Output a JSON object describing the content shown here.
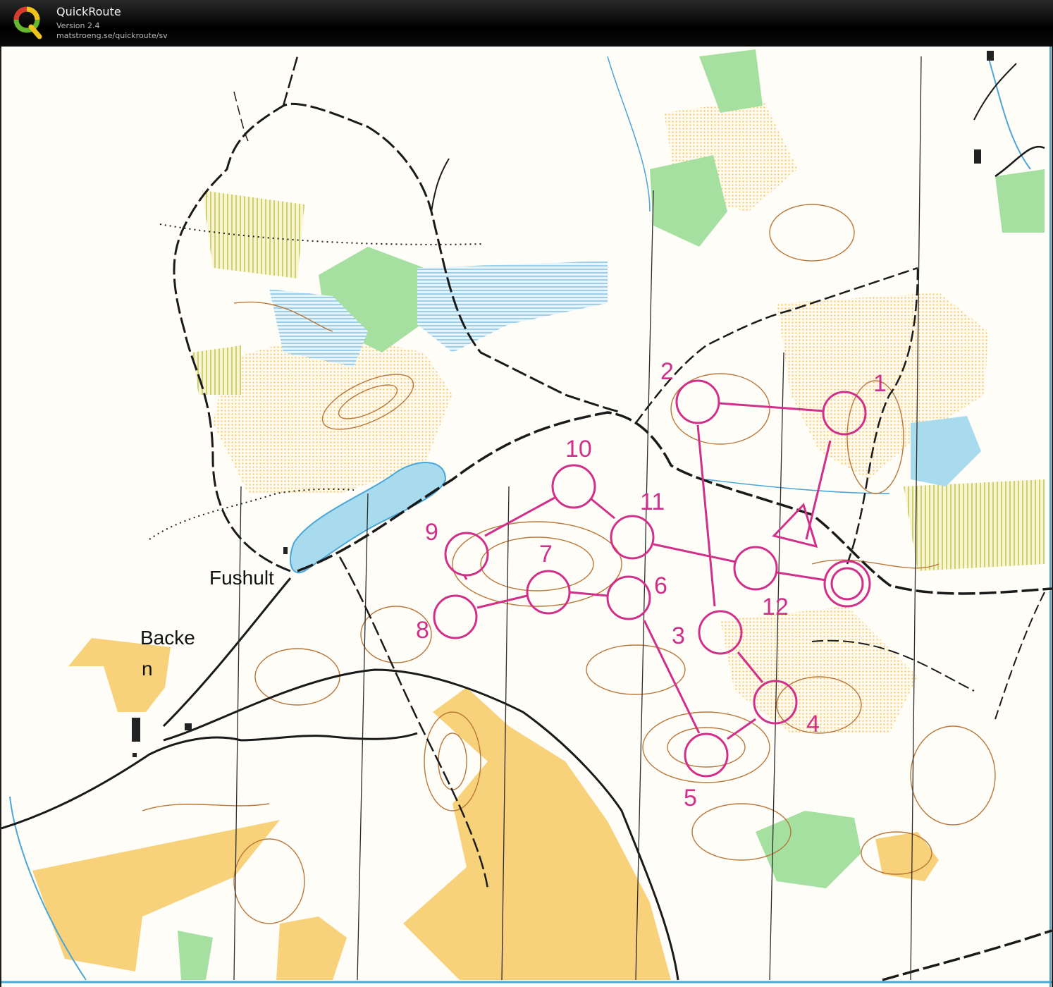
{
  "app": {
    "title": "QuickRoute",
    "version": "Version 2.4",
    "url": "matstroeng.se/quickroute/sv",
    "logo_icon": "quickroute-q-logo-icon"
  },
  "map": {
    "place_names": {
      "fushult": "Fushult",
      "backe_line1": "Backe",
      "backe_line2": "n"
    },
    "course": {
      "color": "#d0308a",
      "start_icon": "start-triangle-icon",
      "finish_icon": "finish-double-circle-icon",
      "controls": [
        {
          "label": "1"
        },
        {
          "label": "2"
        },
        {
          "label": "3"
        },
        {
          "label": "4"
        },
        {
          "label": "5"
        },
        {
          "label": "6"
        },
        {
          "label": "7"
        },
        {
          "label": "8"
        },
        {
          "label": "9"
        },
        {
          "label": "10"
        },
        {
          "label": "11"
        },
        {
          "label": "12"
        }
      ]
    },
    "colors": {
      "open_land": "#f7d27a",
      "rough_open": "#fbe7b0",
      "water": "#a9dbef",
      "marsh": "#6fb5dc",
      "green": "#a5e0a0",
      "contour": "#b9773a",
      "road": "#1a1a1a",
      "frame": "#1e1e1e"
    }
  }
}
